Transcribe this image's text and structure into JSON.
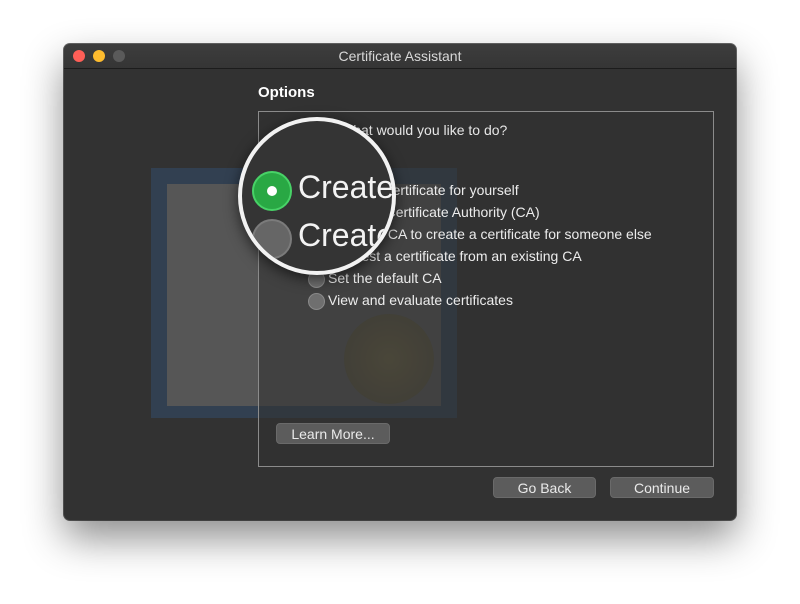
{
  "window": {
    "title": "Certificate Assistant"
  },
  "main": {
    "section_title": "Options",
    "question": "What would you like to do?",
    "options": [
      {
        "label": "Create a certificate for yourself",
        "selected": true
      },
      {
        "label": "Create a Certificate Authority (CA)",
        "selected": false
      },
      {
        "label": "Use your CA to create a certificate for someone else",
        "selected": false
      },
      {
        "label": "Request a certificate from an existing CA",
        "selected": false
      },
      {
        "label": "Set the default CA",
        "selected": false
      },
      {
        "label": "View and evaluate certificates",
        "selected": false
      }
    ],
    "learn_more": "Learn More..."
  },
  "footer": {
    "go_back": "Go Back",
    "continue": "Continue"
  },
  "magnifier": {
    "line1": "Create",
    "line2": "Create"
  }
}
